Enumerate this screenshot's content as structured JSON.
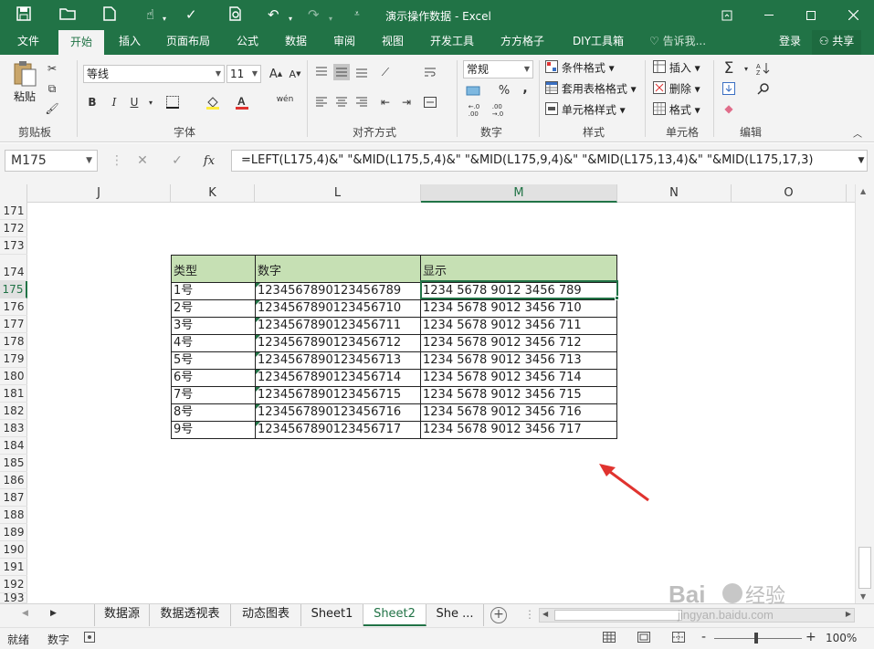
{
  "window": {
    "title": "演示操作数据 - Excel"
  },
  "menu": {
    "tabs": [
      "文件",
      "开始",
      "插入",
      "页面布局",
      "公式",
      "数据",
      "审阅",
      "视图",
      "开发工具",
      "方方格子",
      "DIY工具箱"
    ],
    "active": "开始",
    "tell_me": "告诉我...",
    "login": "登录",
    "share": "共享"
  },
  "ribbon": {
    "clipboard": {
      "paste": "粘贴",
      "label": "剪贴板"
    },
    "font": {
      "name": "等线",
      "size": "11",
      "label": "字体",
      "bold": "B",
      "italic": "I",
      "underline": "U",
      "phonetic": "wén"
    },
    "alignment": {
      "label": "对齐方式"
    },
    "number": {
      "format": "常规",
      "percent": "%",
      "comma": ",",
      "label": "数字"
    },
    "styles": {
      "conditional": "条件格式",
      "table": "套用表格格式",
      "cell": "单元格样式",
      "label": "样式"
    },
    "cells": {
      "insert": "插入",
      "delete": "删除",
      "format": "格式",
      "label": "单元格"
    },
    "editing": {
      "label": "编辑"
    }
  },
  "formula_bar": {
    "name_box": "M175",
    "fx": "fx",
    "formula": "=LEFT(L175,4)&\" \"&MID(L175,5,4)&\" \"&MID(L175,9,4)&\" \"&MID(L175,13,4)&\" \"&MID(L175,17,3)"
  },
  "columns": [
    "J",
    "K",
    "L",
    "M",
    "N",
    "O"
  ],
  "selected_column": "M",
  "rows": [
    "171",
    "172",
    "173",
    "174",
    "175",
    "176",
    "177",
    "178",
    "179",
    "180",
    "181",
    "182",
    "183",
    "184",
    "185",
    "186",
    "187",
    "188",
    "189",
    "190",
    "191",
    "192",
    "193"
  ],
  "selected_row": "175",
  "table": {
    "headers": [
      "类型",
      "数字",
      "显示"
    ],
    "rows": [
      [
        "1号",
        "1234567890123456789",
        "1234 5678 9012 3456 789"
      ],
      [
        "2号",
        "1234567890123456710",
        "1234 5678 9012 3456 710"
      ],
      [
        "3号",
        "1234567890123456711",
        "1234 5678 9012 3456 711"
      ],
      [
        "4号",
        "1234567890123456712",
        "1234 5678 9012 3456 712"
      ],
      [
        "5号",
        "1234567890123456713",
        "1234 5678 9012 3456 713"
      ],
      [
        "6号",
        "1234567890123456714",
        "1234 5678 9012 3456 714"
      ],
      [
        "7号",
        "1234567890123456715",
        "1234 5678 9012 3456 715"
      ],
      [
        "8号",
        "1234567890123456716",
        "1234 5678 9012 3456 716"
      ],
      [
        "9号",
        "1234567890123456717",
        "1234 5678 9012 3456 717"
      ]
    ]
  },
  "sheet_tabs": [
    "数据源",
    "数据透视表",
    "动态图表",
    "Sheet1",
    "Sheet2",
    "She ..."
  ],
  "active_sheet": "Sheet2",
  "status": {
    "ready": "就绪",
    "mode": "数字",
    "zoom": "100%",
    "zoom_minus": "-",
    "zoom_plus": "+"
  },
  "watermark": "Baidu 经验 jingyan.baidu.com",
  "colors": {
    "excel_green": "#217346",
    "header_fill": "#c6e0b4",
    "arrow_red": "#e0332f"
  }
}
